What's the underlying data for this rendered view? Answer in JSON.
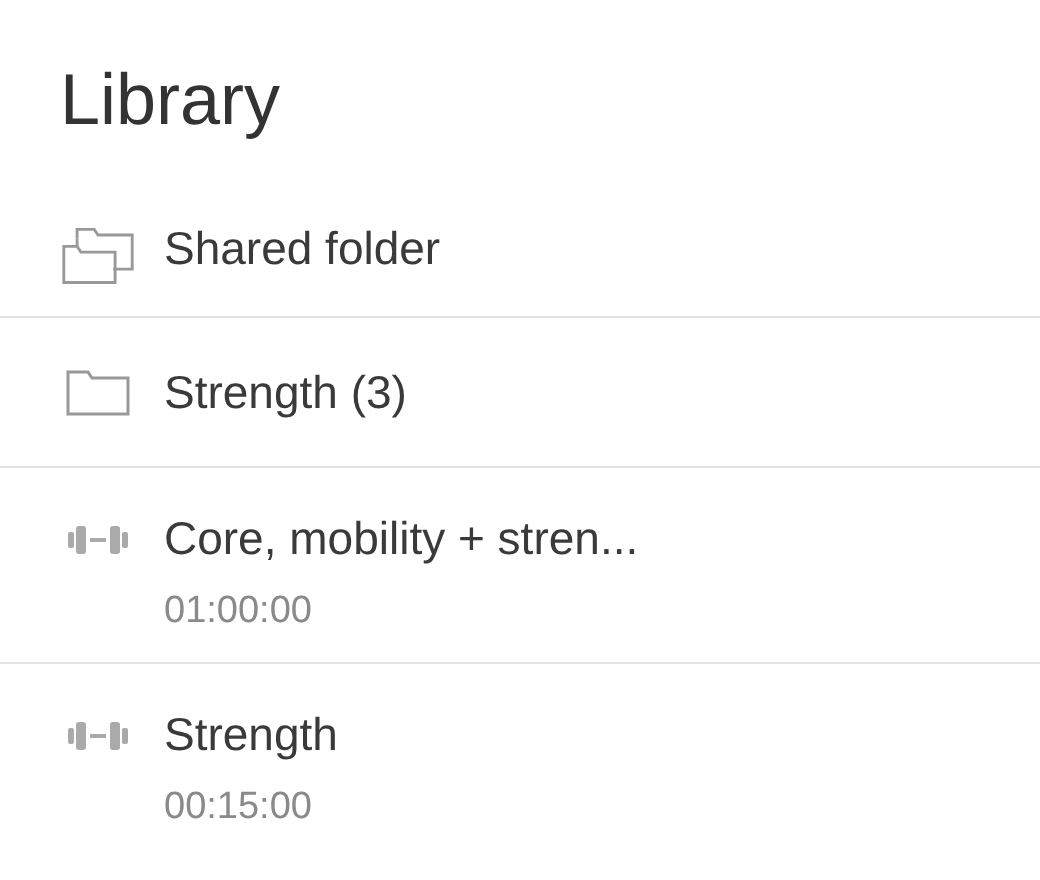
{
  "title": "Library",
  "items": [
    {
      "kind": "shared",
      "label": "Shared folder"
    },
    {
      "kind": "folder",
      "label": "Strength (3)"
    },
    {
      "kind": "workout",
      "label": "Core, mobility + stren...",
      "duration": "01:00:00"
    },
    {
      "kind": "workout",
      "label": "Strength",
      "duration": "00:15:00"
    }
  ]
}
